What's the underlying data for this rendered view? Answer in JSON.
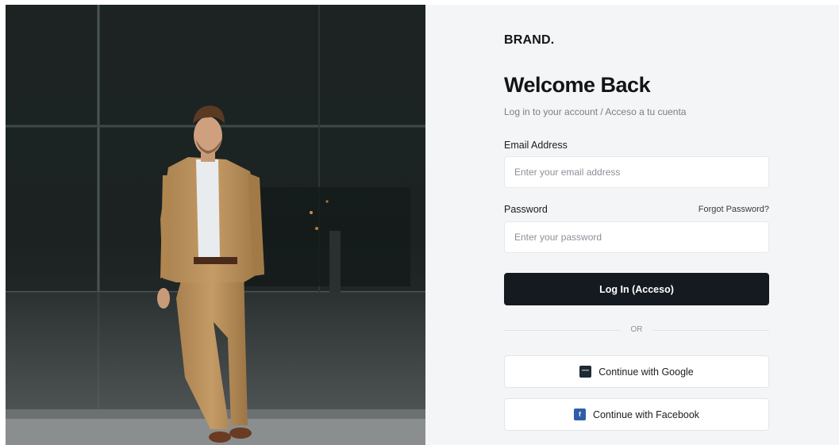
{
  "photo": {
    "alt": "Man in tan suit standing in front of glass building"
  },
  "brand": "BRAND.",
  "title": "Welcome Back",
  "subtitle": "Log in to your account / Acceso a tu cuenta",
  "email": {
    "label": "Email Address",
    "placeholder": "Enter your email address",
    "value": ""
  },
  "password": {
    "label": "Password",
    "placeholder": "Enter your password",
    "value": "",
    "forgot_label": "Forgot Password?"
  },
  "login_button": "Log In (Acceso)",
  "divider_text": "OR",
  "social": {
    "google_label": "Continue with Google",
    "google_icon": "google-icon",
    "facebook_label": "Continue with Facebook",
    "facebook_icon": "facebook-icon",
    "facebook_glyph": "f"
  },
  "colors": {
    "primary": "#151a21",
    "panel_bg": "#f4f5f7",
    "facebook": "#2f5ea8"
  }
}
